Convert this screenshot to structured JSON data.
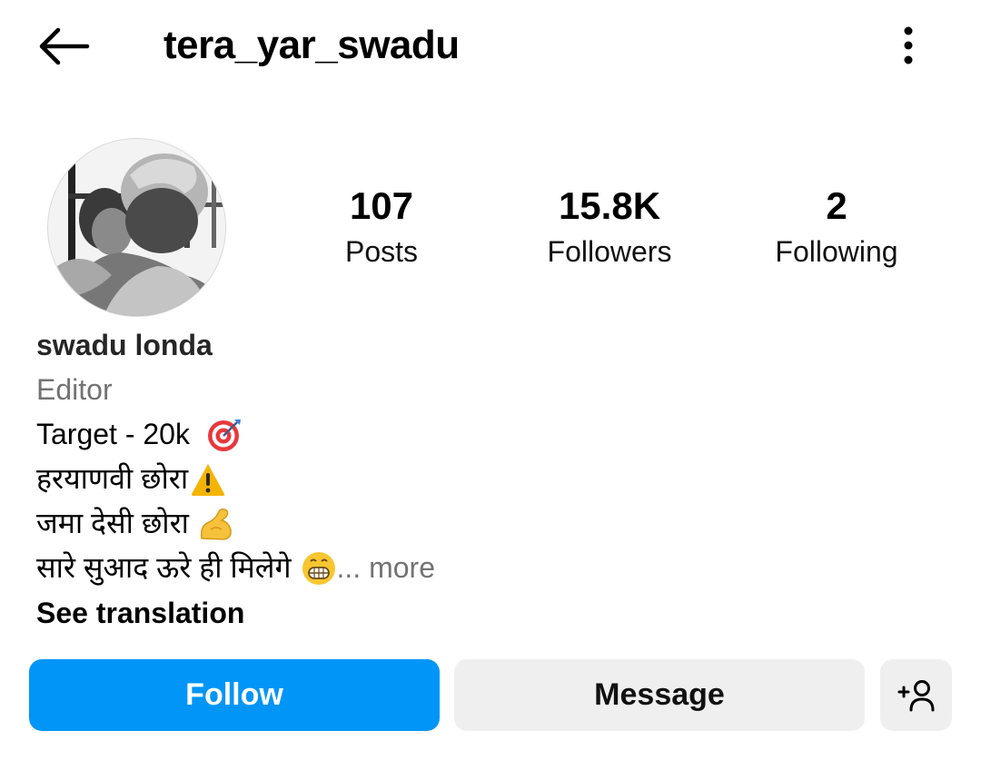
{
  "header": {
    "back_icon": "back-arrow-icon",
    "username": "tera_yar_swadu",
    "more_icon": "more-vertical-icon"
  },
  "profile": {
    "avatar": "avatar",
    "stats": [
      {
        "value": "107",
        "label": "Posts"
      },
      {
        "value": "15.8K",
        "label": "Followers"
      },
      {
        "value": "2",
        "label": "Following"
      }
    ]
  },
  "bio": {
    "name": "swadu londa",
    "category": "Editor",
    "lines": [
      {
        "text": "Target - 20k",
        "emoji": "target-emoji"
      },
      {
        "text": "हरयाणवी छोरा",
        "emoji": "warning-emoji"
      },
      {
        "text": "जमा देसी छोरा",
        "emoji": "flexed-biceps-emoji"
      },
      {
        "text": "सारे सुआद ऊरे ही मिलेगे",
        "emoji": "grinning-face-emoji"
      }
    ],
    "more_label": "... more",
    "see_translation": "See translation"
  },
  "actions": {
    "follow_label": "Follow",
    "message_label": "Message",
    "add_user_icon": "add-person-icon"
  },
  "colors": {
    "follow_button": "#0095f6",
    "secondary_button": "#efefef",
    "muted_text": "#737373"
  }
}
